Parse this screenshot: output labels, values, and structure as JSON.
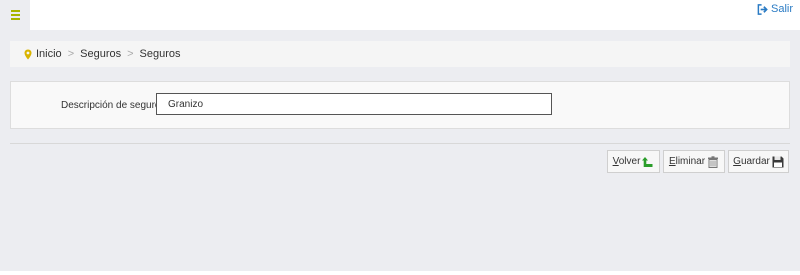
{
  "header": {
    "logout_label": "Salir"
  },
  "breadcrumb": {
    "items": [
      "Inicio",
      "Seguros",
      "Seguros"
    ],
    "separator": ">"
  },
  "form": {
    "description_label": "Descripción de seguro",
    "description_value": "Granizo"
  },
  "actions": {
    "volver": {
      "first": "V",
      "rest": "olver"
    },
    "eliminar": {
      "first": "E",
      "rest": "liminar"
    },
    "guardar": {
      "first": "G",
      "rest": "uardar"
    }
  },
  "colors": {
    "accent_menu": "#a8b400",
    "logout_link": "#2a7bc4",
    "back_arrow": "#2a9d2a",
    "background": "#ecedf1"
  },
  "icons": {
    "menu": "hamburger-icon",
    "logout": "sign-out-icon",
    "breadcrumb": "map-pin-icon",
    "volver": "back-arrow-icon",
    "eliminar": "trash-icon",
    "guardar": "floppy-disk-icon"
  }
}
